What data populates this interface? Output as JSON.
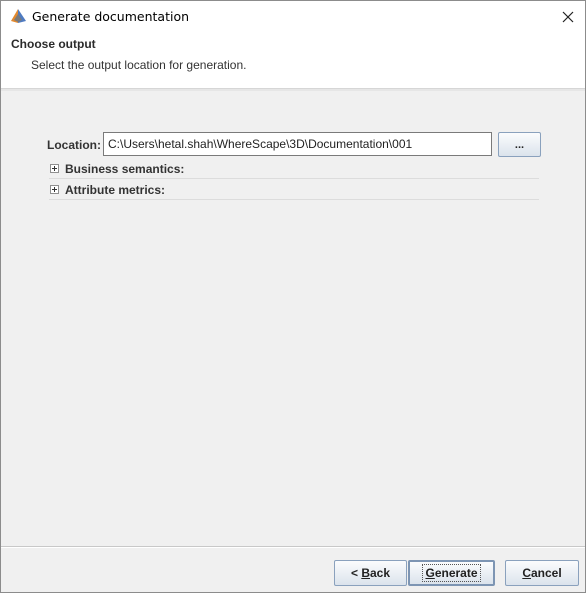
{
  "window": {
    "title": "Generate documentation"
  },
  "header": {
    "title": "Choose output",
    "subtitle": "Select the output location for generation."
  },
  "location": {
    "label": "Location:",
    "value": "C:\\Users\\hetal.shah\\WhereScape\\3D\\Documentation\\001",
    "browse_label": "..."
  },
  "sections": [
    {
      "label": "Business semantics:",
      "expanded": false
    },
    {
      "label": "Attribute metrics:",
      "expanded": false
    }
  ],
  "footer": {
    "back_prefix": "< ",
    "back_mnemonic": "B",
    "back_rest": "ack",
    "generate_mnemonic": "G",
    "generate_rest": "enerate",
    "cancel_mnemonic": "C",
    "cancel_rest": "ancel"
  },
  "icons": {
    "app": "wherescape-app-icon",
    "close": "close-icon",
    "expand": "expand-plus-icon"
  }
}
